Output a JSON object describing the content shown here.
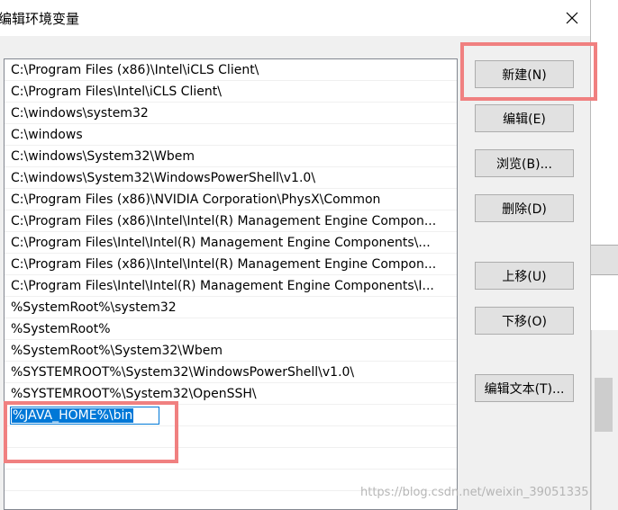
{
  "dialog": {
    "title": "编辑环境变量",
    "close_glyph": "✕"
  },
  "path_list": {
    "items": [
      "C:\\Program Files (x86)\\Intel\\iCLS Client\\",
      "C:\\Program Files\\Intel\\iCLS Client\\",
      "C:\\windows\\system32",
      "C:\\windows",
      "C:\\windows\\System32\\Wbem",
      "C:\\windows\\System32\\WindowsPowerShell\\v1.0\\",
      "C:\\Program Files (x86)\\NVIDIA Corporation\\PhysX\\Common",
      "C:\\Program Files (x86)\\Intel\\Intel(R) Management Engine Compon...",
      "C:\\Program Files\\Intel\\Intel(R) Management Engine Components\\...",
      "C:\\Program Files (x86)\\Intel\\Intel(R) Management Engine Compon...",
      "C:\\Program Files\\Intel\\Intel(R) Management Engine Components\\I...",
      "%SystemRoot%\\system32",
      "%SystemRoot%",
      "%SystemRoot%\\System32\\Wbem",
      "%SYSTEMROOT%\\System32\\WindowsPowerShell\\v1.0\\",
      "%SYSTEMROOT%\\System32\\OpenSSH\\"
    ],
    "editing_value": "%JAVA_HOME%\\bin"
  },
  "buttons": {
    "new": "新建(N)",
    "edit": "编辑(E)",
    "browse": "浏览(B)...",
    "delete": "删除(D)",
    "move_up": "上移(U)",
    "move_down": "下移(O)",
    "edit_text": "编辑文本(T)..."
  },
  "watermark": "https://blog.csdn.net/weixin_39051335",
  "colors": {
    "annotation": "#f08080",
    "selection": "#0078d7",
    "button_bg": "#e1e1e1"
  }
}
